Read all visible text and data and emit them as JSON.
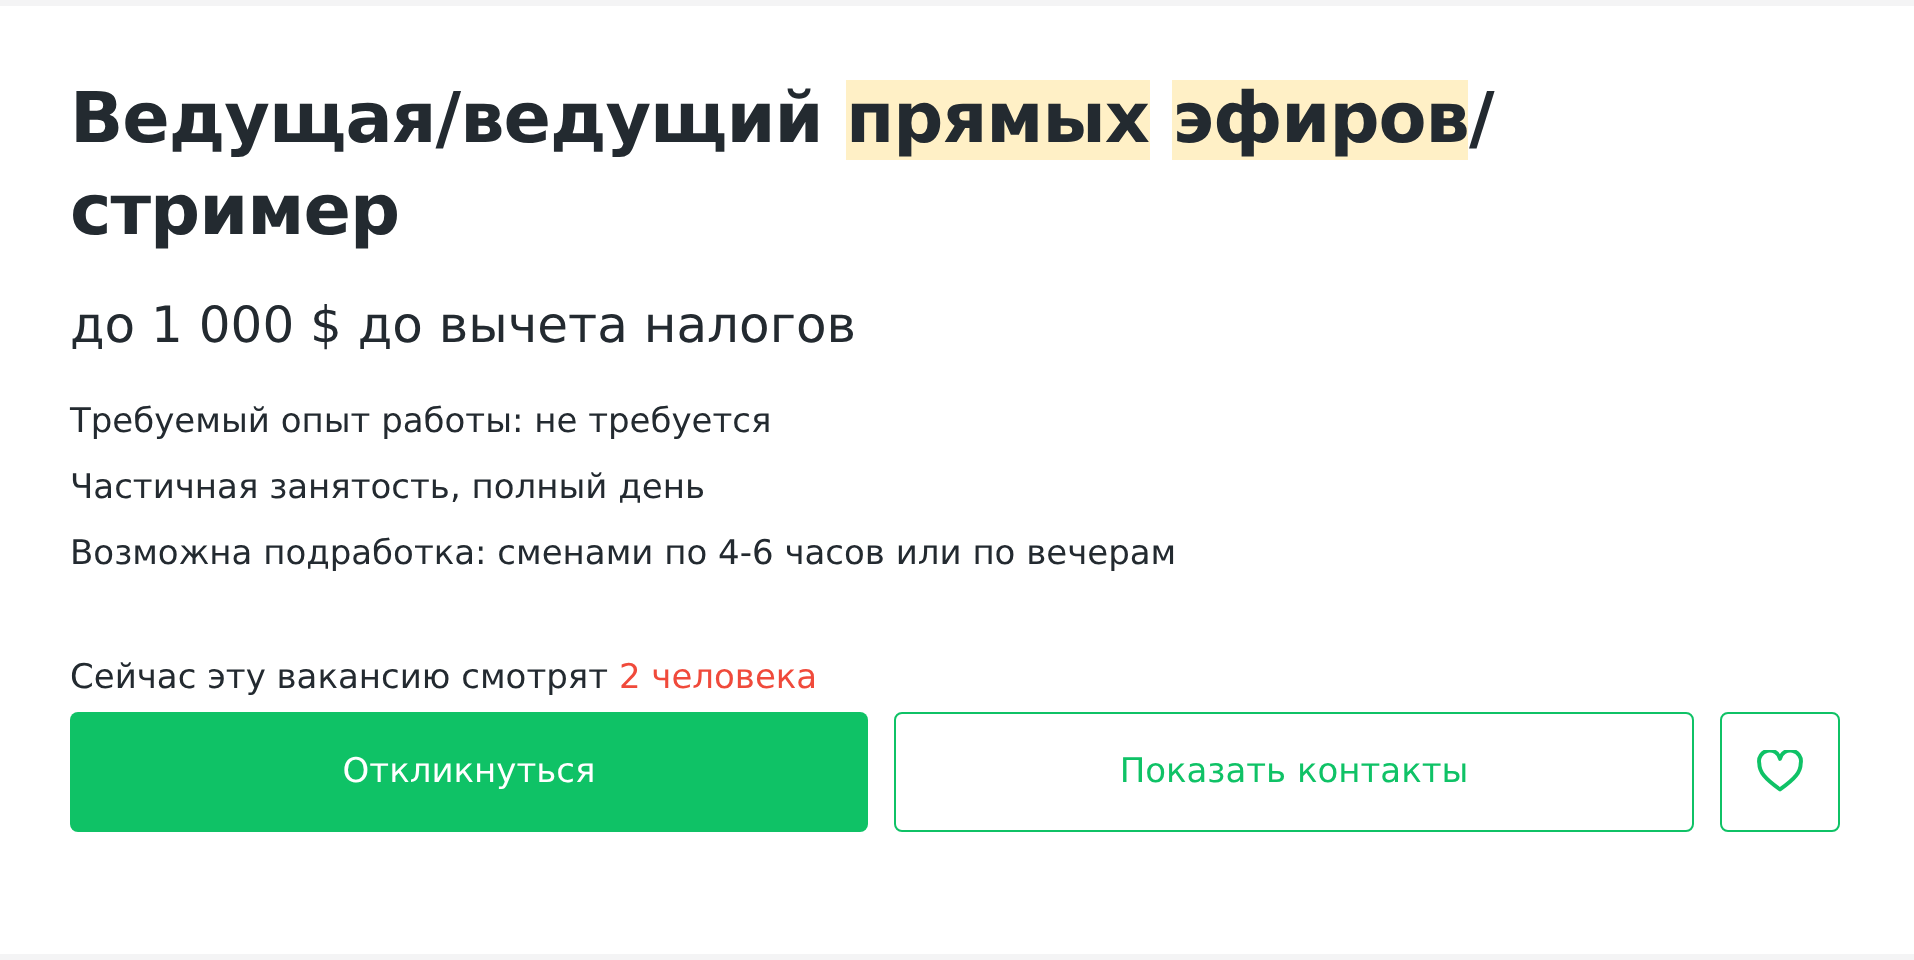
{
  "title": [
    {
      "text": "Ведущая/ведущий",
      "highlighted": false,
      "space_before": false
    },
    {
      "text": "прямых",
      "highlighted": true,
      "space_before": true
    },
    {
      "text": "эфиров",
      "highlighted": true,
      "space_before": true
    },
    {
      "text": "/ стример",
      "highlighted": false,
      "space_before": false
    }
  ],
  "salary": "до 1 000 $ до вычета налогов",
  "details": [
    "Требуемый опыт работы: не требуется",
    "Частичная занятость, полный день",
    "Возможна подработка: сменами по 4-6 часов или по вечерам"
  ],
  "viewers": {
    "text": "Сейчас эту вакансию смотрят",
    "count": "2 человека"
  },
  "buttons": {
    "respond": "Откликнуться",
    "contacts": "Показать контакты",
    "favorite": {
      "selected": false
    }
  }
}
